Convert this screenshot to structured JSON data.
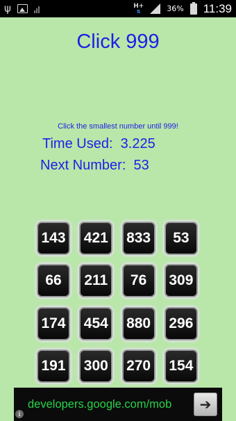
{
  "status_bar": {
    "time": "11:39",
    "battery_percent": "36%",
    "network_type": "H+",
    "icons": [
      "usb-icon",
      "image-notification-icon",
      "signal-weak-icon",
      "hplus-data-icon",
      "cell-signal-icon",
      "battery-icon"
    ]
  },
  "app": {
    "title": "Click 999",
    "instruction": "Click the smallest number until 999!",
    "time_used_label": "Time Used:",
    "time_used_value": "3.225",
    "next_number_label": "Next Number:",
    "next_number_value": "53"
  },
  "grid": {
    "numbers": [
      "143",
      "421",
      "833",
      "53",
      "66",
      "211",
      "76",
      "309",
      "174",
      "454",
      "880",
      "296",
      "191",
      "300",
      "270",
      "154"
    ]
  },
  "ad": {
    "text": "developers.google.com/mob",
    "arrow_icon": "arrow-right-icon",
    "info_icon": "info-icon"
  },
  "colors": {
    "background": "#b9e6a9",
    "text_blue": "#1e1ee8",
    "button_dark": "#111111",
    "ad_text_green": "#28d24a"
  }
}
